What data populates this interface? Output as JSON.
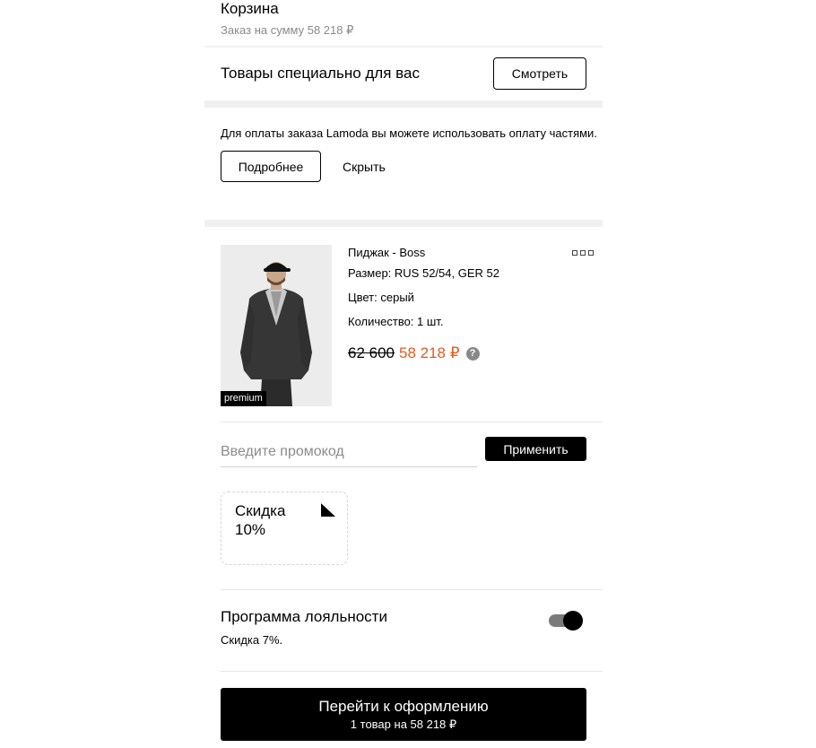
{
  "cart": {
    "title": "Корзина",
    "subtitle": "Заказ на сумму 58 218 ₽"
  },
  "special_offer": {
    "text": "Товары специально для вас",
    "button_label": "Смотреть"
  },
  "installment": {
    "text": "Для оплаты заказа Lamoda вы можете использовать оплату частями.",
    "more_label": "Подробнее",
    "hide_label": "Скрыть"
  },
  "product": {
    "name": "Пиджак - Boss",
    "size": "Размер: RUS 52/54, GER 52",
    "color": "Цвет: серый",
    "quantity": "Количество: 1 шт.",
    "old_price": "62 600",
    "new_price": "58 218 ₽",
    "badge": "premium",
    "help_icon": "question-icon",
    "menu_icon": "more-dots-icon"
  },
  "promo": {
    "placeholder": "Введите промокод",
    "apply_label": "Применить"
  },
  "coupon": {
    "line1": "Скидка",
    "line2": "10%"
  },
  "loyalty": {
    "title": "Программа лояльности",
    "subtitle": "Скидка 7%.",
    "enabled": true
  },
  "checkout": {
    "main_label": "Перейти к оформлению",
    "sub_label": "1 товар на 58 218 ₽"
  },
  "colors": {
    "accent_price": "#e45b21",
    "primary": "#000000",
    "muted_text": "#8a8a8a",
    "separator": "#f0f0f0"
  }
}
